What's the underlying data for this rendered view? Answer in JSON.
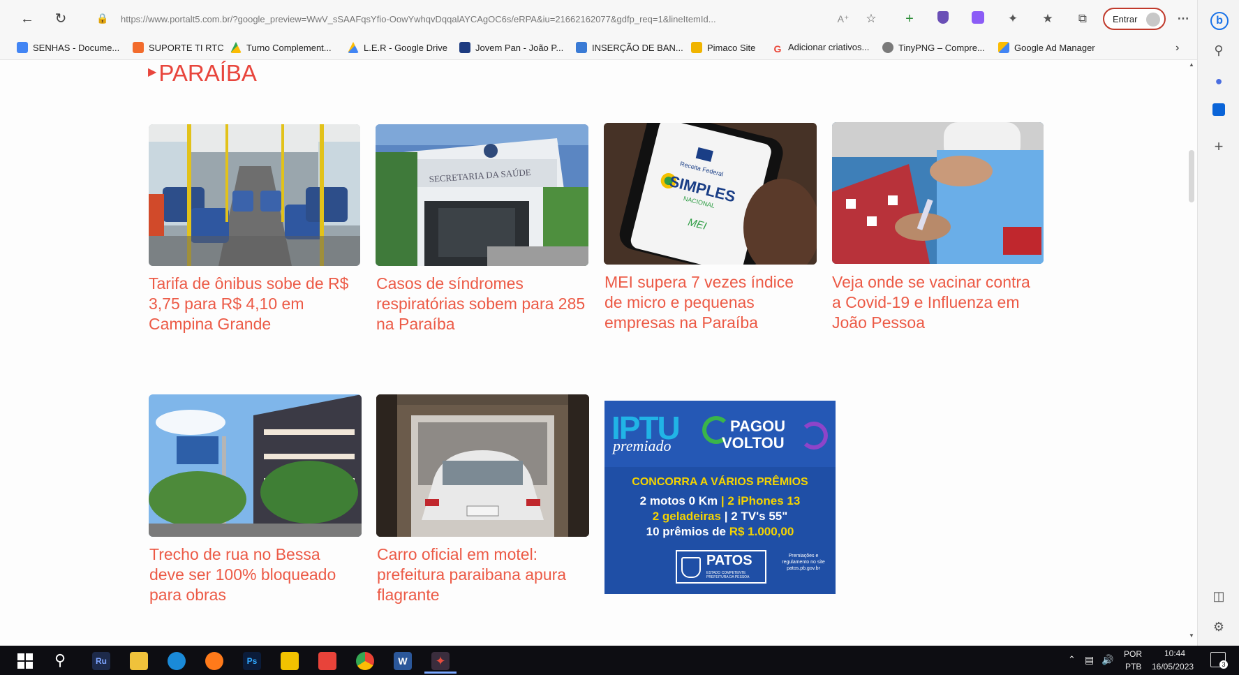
{
  "browser": {
    "url": "https://www.portalt5.com.br/?google_preview=WwV_sSAAFqsYfio-OowYwhqvDqqalAYCAgOC6s/eRPA&iu=21662162077&gdfp_req=1&lineItemId...",
    "signin_label": "Entrar"
  },
  "bookmarks": [
    {
      "label": "SENHAS - Docume...",
      "icon": "docs-icon",
      "color": "#4285f4"
    },
    {
      "label": "SUPORTE TI RTC",
      "icon": "folder-icon",
      "color": "#f26b2c"
    },
    {
      "label": "Turno Complement...",
      "icon": "drive-icon",
      "color": "#34a853"
    },
    {
      "label": "L.E.R - Google Drive",
      "icon": "drive-icon",
      "color": "#fbbc04"
    },
    {
      "label": "Jovem Pan - João P...",
      "icon": "site-icon",
      "color": "#1d3b80"
    },
    {
      "label": "INSERÇÃO DE BAN...",
      "icon": "site-icon",
      "color": "#3a7bd5"
    },
    {
      "label": "Pimaco Site",
      "icon": "site-icon",
      "color": "#f0b400"
    },
    {
      "label": "Adicionar criativos...",
      "icon": "google-icon",
      "color": "#ea4335"
    },
    {
      "label": "TinyPNG – Compre...",
      "icon": "panda-icon",
      "color": "#7a7a7a"
    },
    {
      "label": "Google Ad Manager",
      "icon": "admanager-icon",
      "color": "#fbbc04"
    }
  ],
  "section": {
    "title": "PARAÍBA"
  },
  "news": [
    {
      "title": "Tarifa de ônibus sobe de R$ 3,75 para R$ 4,10 em Campina Grande",
      "image": "bus-interior"
    },
    {
      "title": "Casos de síndromes respiratórias sobem para 285 na Paraíba",
      "image": "health-building"
    },
    {
      "title": "MEI supera 7 vezes índice de micro e pequenas empresas na Paraíba",
      "image": "phone-simples",
      "image_texts": {
        "top": "Receita Federal",
        "brand": "SIMPLES",
        "sub": "NACIONAL",
        "mei": "MEI"
      }
    },
    {
      "title": "Veja onde se vacinar contra a Covid-19 e Influenza em João Pessoa",
      "image": "vaccination"
    },
    {
      "title": "Trecho de rua no Bessa deve ser 100% bloqueado para obras",
      "image": "street-buildings"
    },
    {
      "title": "Carro oficial em motel: prefeitura paraibana apura flagrante",
      "image": "car-motel"
    }
  ],
  "ad": {
    "iptu": "IPTU",
    "premiado": "premiado",
    "pagou": "PAGOU",
    "voltou": "VOLTOU",
    "headline": "CONCORRA A VÁRIOS PRÊMIOS",
    "line1a": "2 motos 0 Km",
    "line1b": "2 iPhones 13",
    "line2a": "2 geladeiras",
    "line2b": "2 TV's 55\"",
    "line3a": "10 prêmios de",
    "line3b": "R$ 1.000,00",
    "city": "PATOS",
    "city_sub": "ESTADO COMPETENTE PREFEITURA DA PESSOA",
    "note": "Premiações e regulamento no site patos.pb.gov.br"
  },
  "taskbar": {
    "lang_top": "POR",
    "lang_bottom": "PTB",
    "time": "10:44",
    "date": "16/05/2023",
    "notif_count": "3",
    "app_ru": "Ru",
    "app_ps": "Ps",
    "app_w": "W"
  }
}
